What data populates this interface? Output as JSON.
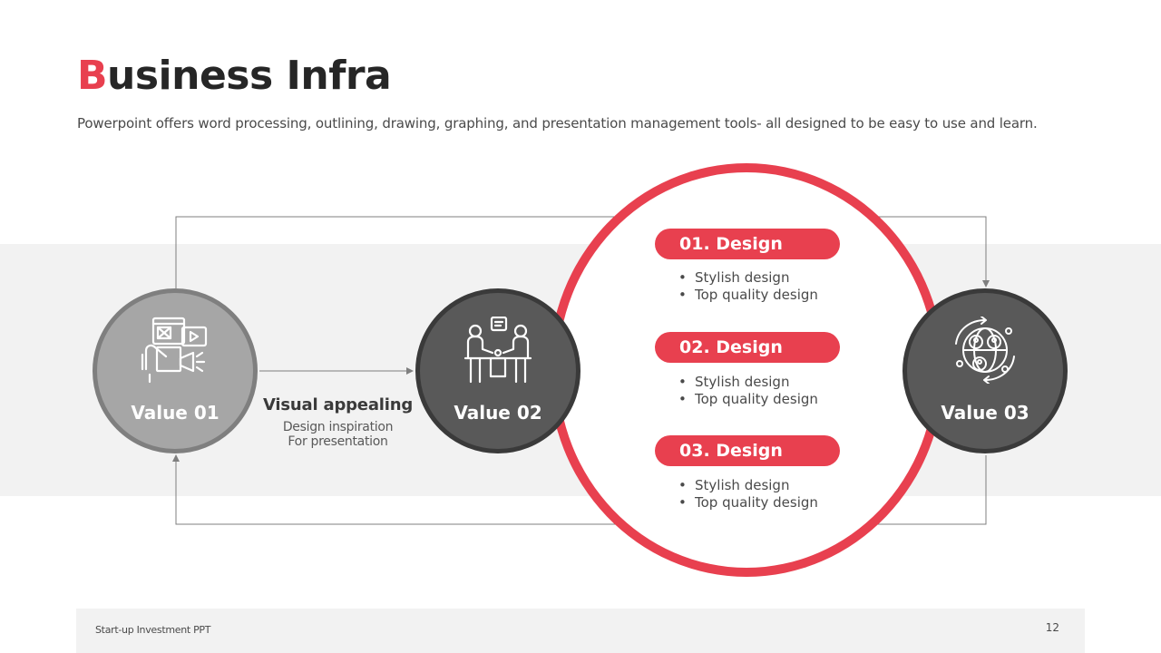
{
  "header": {
    "title_first_letter": "B",
    "title_rest": "usiness Infra",
    "subtitle": "Powerpoint offers word processing, outlining, drawing, graphing, and presentation management tools- all designed to be easy to use and learn."
  },
  "nodes": [
    {
      "label": "Value 01",
      "icon": "web-design-icon"
    },
    {
      "label": "Value 02",
      "icon": "handshake-meeting-icon"
    },
    {
      "label": "Value 03",
      "icon": "global-network-icon"
    }
  ],
  "caption": {
    "heading": "Visual appealing",
    "line1": "Design inspiration",
    "line2": "For presentation"
  },
  "designs": [
    {
      "title": "01. Design",
      "bullets": [
        "Stylish design",
        "Top quality design"
      ]
    },
    {
      "title": "02. Design",
      "bullets": [
        "Stylish design",
        "Top quality design"
      ]
    },
    {
      "title": "03. Design",
      "bullets": [
        "Stylish design",
        "Top quality design"
      ]
    }
  ],
  "footer": {
    "left": "Start-up Investment PPT",
    "page": "12"
  },
  "colors": {
    "accent": "#e8404f",
    "node_light": "#a6a6a6",
    "node_dark": "#595959",
    "band": "#f2f2f2"
  }
}
